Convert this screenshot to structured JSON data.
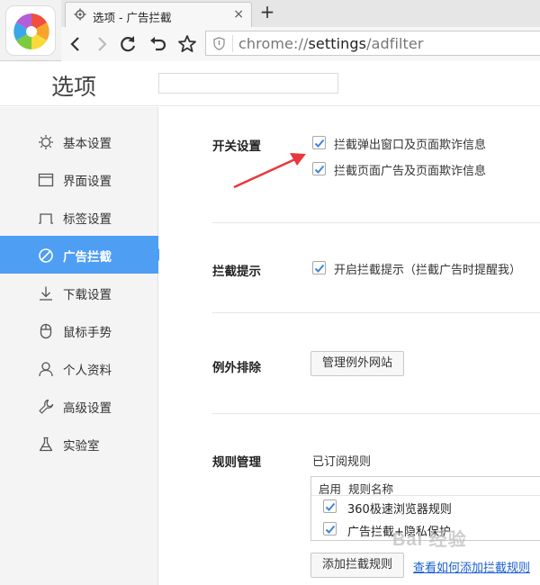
{
  "browser": {
    "tab_title": "选项 - 广告拦截",
    "tab_close": "×",
    "new_tab": "+",
    "url_scheme": "chrome://",
    "url_host": "settings",
    "url_path": "/adfilter"
  },
  "header": {
    "title": "选项",
    "search_value": ""
  },
  "sidebar": {
    "items": [
      {
        "label": "基本设置",
        "icon": "gear-icon"
      },
      {
        "label": "界面设置",
        "icon": "window-icon"
      },
      {
        "label": "标签设置",
        "icon": "tab-icon"
      },
      {
        "label": "广告拦截",
        "icon": "block-icon",
        "active": true
      },
      {
        "label": "下载设置",
        "icon": "download-icon"
      },
      {
        "label": "鼠标手势",
        "icon": "mouse-icon"
      },
      {
        "label": "个人资料",
        "icon": "user-icon"
      },
      {
        "label": "高级设置",
        "icon": "wrench-icon"
      },
      {
        "label": "实验室",
        "icon": "flask-icon"
      }
    ]
  },
  "sections": {
    "switch": {
      "title": "开关设置",
      "options": [
        {
          "label": "拦截弹出窗口及页面欺诈信息",
          "checked": true
        },
        {
          "label": "拦截页面广告及页面欺诈信息",
          "checked": true
        }
      ]
    },
    "hint": {
      "title": "拦截提示",
      "option": {
        "label": "开启拦截提示（拦截广告时提醒我）",
        "checked": true
      }
    },
    "exception": {
      "title": "例外排除",
      "button": "管理例外网站"
    },
    "rules": {
      "title": "规则管理",
      "subscribed_label": "已订阅规则",
      "col_enable": "启用",
      "col_name": "规则名称",
      "rows": [
        {
          "name": "360极速浏览器规则",
          "checked": true
        },
        {
          "name": "广告拦截+隐私保护",
          "checked": true
        }
      ],
      "add_button": "添加拦截规则",
      "help_link": "查看如何添加拦截规则"
    }
  },
  "watermark": "Bai 经验",
  "colors": {
    "accent": "#4e9ef3",
    "check": "#3f86d8",
    "arrow": "#e8383d",
    "link": "#1a5fd1"
  }
}
